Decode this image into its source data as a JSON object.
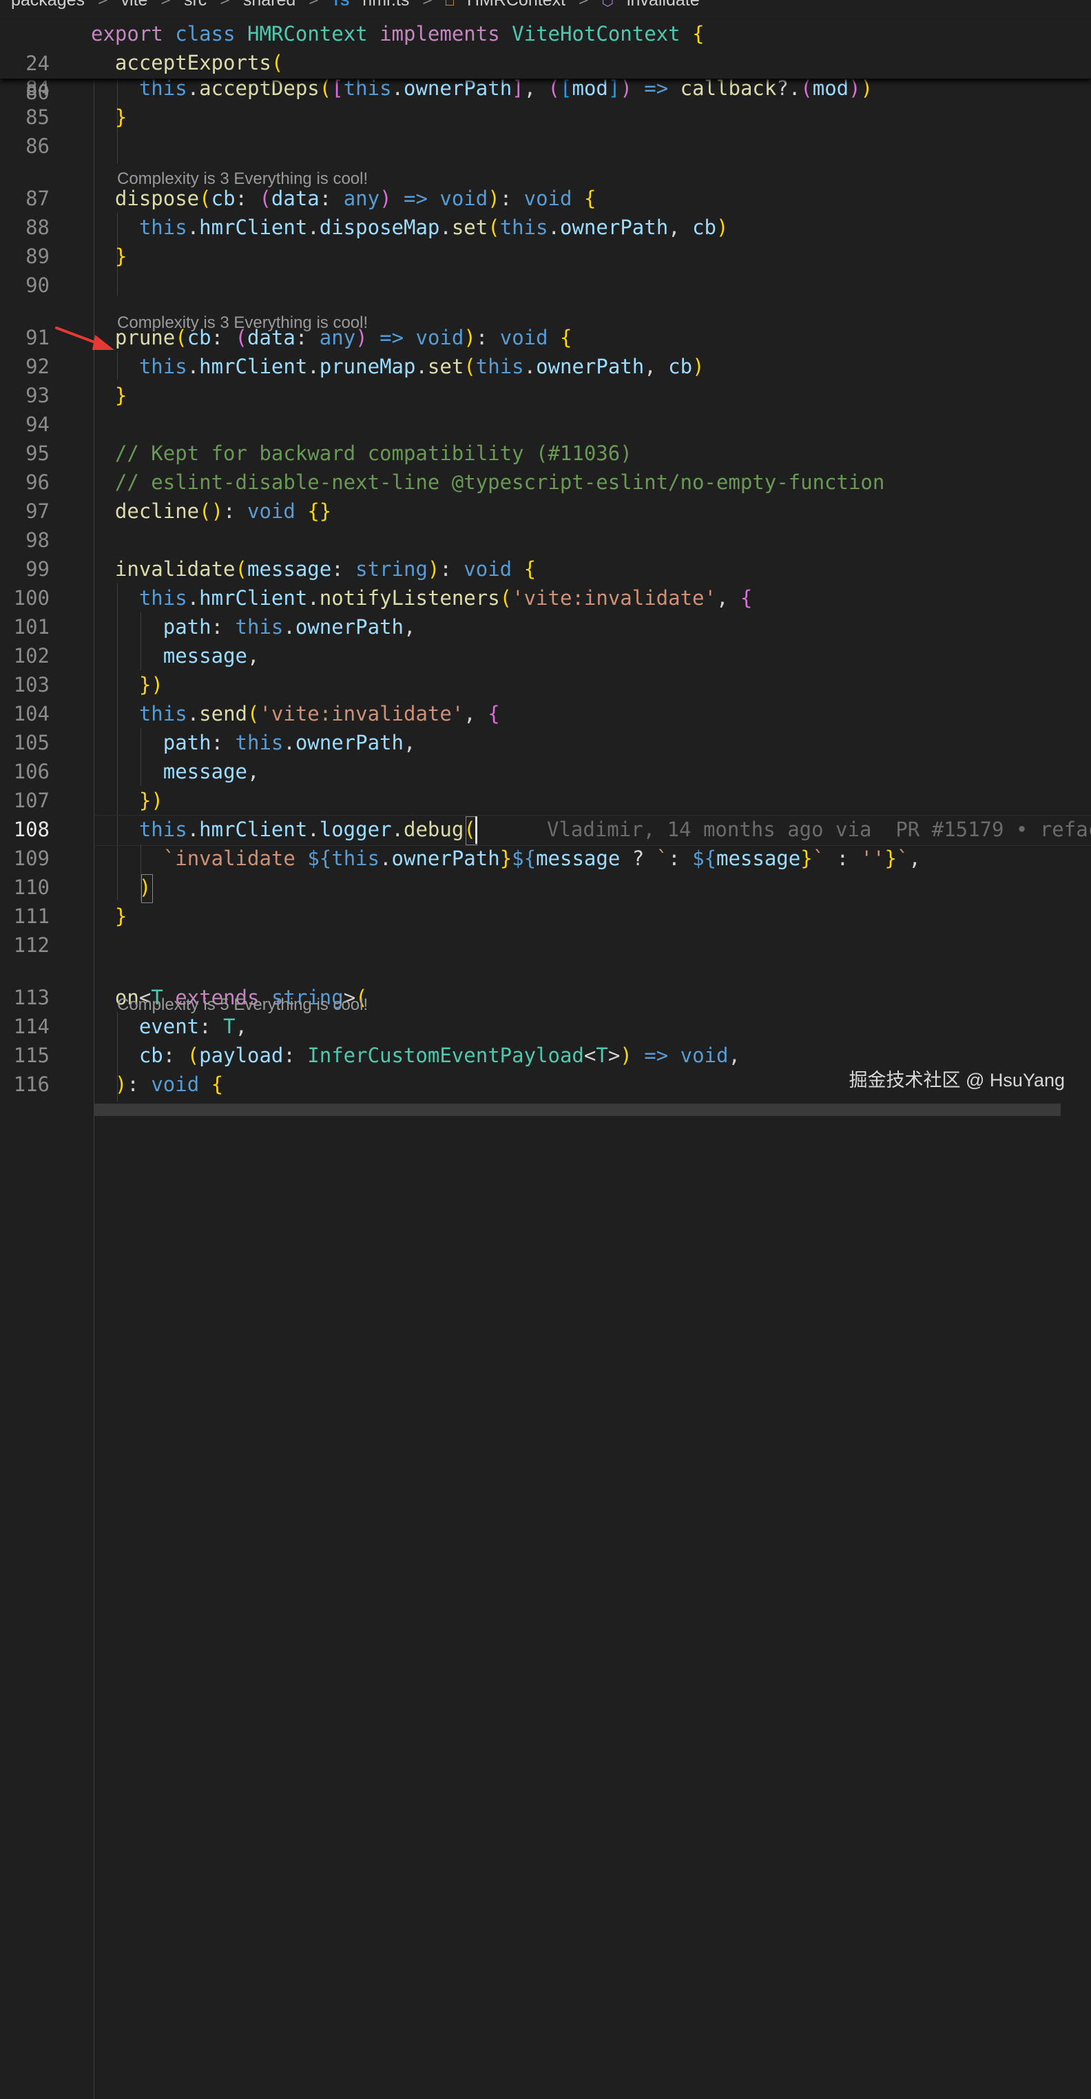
{
  "breadcrumb": {
    "items": [
      "packages",
      "vite",
      "src",
      "shared",
      "hmr.ts",
      "HMRContext",
      "invalidate"
    ],
    "file_badge": "TS",
    "separator": ">"
  },
  "sticky_lines": [
    {
      "number": "24",
      "text": "export class HMRContext implements ViteHotContext {"
    },
    {
      "number": "80",
      "text": "  acceptExports("
    }
  ],
  "code_lens": [
    "Complexity is 3 Everything is cool!",
    "Complexity is 3 Everything is cool!",
    "Complexity is 5 Everything is cool!"
  ],
  "lines": [
    {
      "number": "84",
      "text": "    this.acceptDeps([this.ownerPath], ([mod]) => callback?.(mod))"
    },
    {
      "number": "85",
      "text": "  }"
    },
    {
      "number": "86",
      "text": ""
    },
    {
      "number": "87",
      "text": "  dispose(cb: (data: any) => void): void {"
    },
    {
      "number": "88",
      "text": "    this.hmrClient.disposeMap.set(this.ownerPath, cb)"
    },
    {
      "number": "89",
      "text": "  }"
    },
    {
      "number": "90",
      "text": ""
    },
    {
      "number": "91",
      "text": "  prune(cb: (data: any) => void): void {"
    },
    {
      "number": "92",
      "text": "    this.hmrClient.pruneMap.set(this.ownerPath, cb)"
    },
    {
      "number": "93",
      "text": "  }"
    },
    {
      "number": "94",
      "text": ""
    },
    {
      "number": "95",
      "text": "  // Kept for backward compatibility (#11036)"
    },
    {
      "number": "96",
      "text": "  // eslint-disable-next-line @typescript-eslint/no-empty-function"
    },
    {
      "number": "97",
      "text": "  decline(): void {}"
    },
    {
      "number": "98",
      "text": ""
    },
    {
      "number": "99",
      "text": "  invalidate(message: string): void {"
    },
    {
      "number": "100",
      "text": "    this.hmrClient.notifyListeners('vite:invalidate', {"
    },
    {
      "number": "101",
      "text": "      path: this.ownerPath,"
    },
    {
      "number": "102",
      "text": "      message,"
    },
    {
      "number": "103",
      "text": "    })"
    },
    {
      "number": "104",
      "text": "    this.send('vite:invalidate', {"
    },
    {
      "number": "105",
      "text": "      path: this.ownerPath,"
    },
    {
      "number": "106",
      "text": "      message,"
    },
    {
      "number": "107",
      "text": "    })"
    },
    {
      "number": "108",
      "text": "    this.hmrClient.logger.debug("
    },
    {
      "number": "109",
      "text": "      `invalidate ${this.ownerPath}${message ? `: ${message}` : ''}`,"
    },
    {
      "number": "110",
      "text": "    )"
    },
    {
      "number": "111",
      "text": "  }"
    },
    {
      "number": "112",
      "text": ""
    },
    {
      "number": "113",
      "text": "  on<T extends string>("
    },
    {
      "number": "114",
      "text": "    event: T,"
    },
    {
      "number": "115",
      "text": "    cb: (payload: InferCustomEventPayload<T>) => void,"
    },
    {
      "number": "116",
      "text": "  ): void {"
    }
  ],
  "active_line": "108",
  "blame": "Vladimir, 14 months ago via  PR #15179 • refac",
  "watermark": "掘金技术社区 @ HsuYang",
  "colors": {
    "background": "#1f1f1f",
    "keyword": "#c586c0",
    "storage": "#569cd6",
    "type": "#4ec9b0",
    "function": "#dcdcaa",
    "property": "#9cdcfe",
    "string": "#ce9178",
    "comment": "#6a9955",
    "bracket1": "#ffd700",
    "bracket2": "#da70d6",
    "bracket3": "#179fff",
    "annotation_arrow": "#e53935"
  },
  "icons": [
    "typescript-file-icon",
    "class-icon",
    "method-icon",
    "arrow-annotation-icon"
  ]
}
